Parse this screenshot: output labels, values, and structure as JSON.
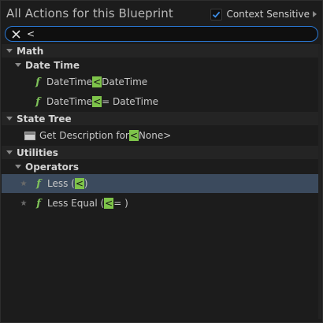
{
  "header": {
    "title": "All Actions for this Blueprint",
    "context_sensitive_label": "Context Sensitive",
    "context_sensitive_checked": true
  },
  "search": {
    "value": "<",
    "placeholder": ""
  },
  "tree": {
    "math": {
      "label": "Math",
      "date_time": {
        "label": "Date Time",
        "items": [
          {
            "pre": "DateTime ",
            "match": "<",
            "post": " DateTime"
          },
          {
            "pre": "DateTime ",
            "match": "<",
            "post": "= DateTime"
          }
        ]
      }
    },
    "state_tree": {
      "label": "State Tree",
      "items": [
        {
          "pre": "Get Description for ",
          "match": "<",
          "post": "None>"
        }
      ]
    },
    "utilities": {
      "label": "Utilities",
      "operators": {
        "label": "Operators",
        "items": [
          {
            "pre": "Less (",
            "match": "<",
            "post": ")",
            "selected": true
          },
          {
            "pre": "Less Equal (",
            "match": "<",
            "post": "= )",
            "selected": false
          }
        ]
      }
    }
  },
  "icons": {
    "function": "function-icon",
    "favorite": "star-icon",
    "struct": "struct-icon",
    "checkbox": "checkmark-icon",
    "clear": "close-icon",
    "expand": "chevron-right-icon",
    "collapse": "triangle-down-icon"
  },
  "colors": {
    "accent": "#2a78d4",
    "match_highlight": "#7ec34a",
    "selected_row": "#3b4a5d",
    "function_icon": "#7fc25a"
  }
}
